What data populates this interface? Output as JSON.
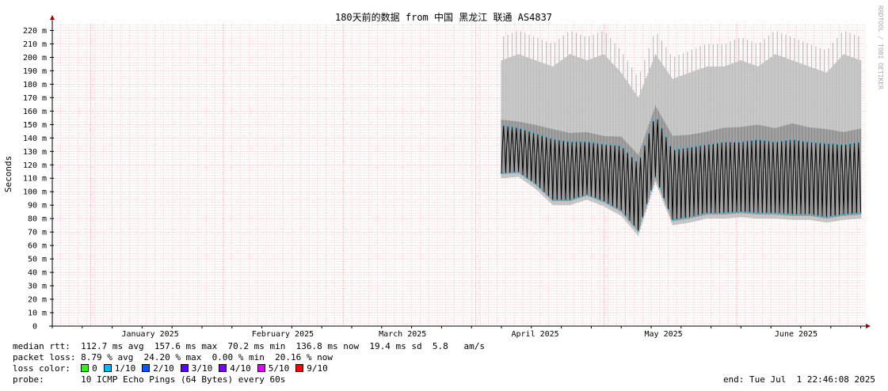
{
  "chart_data": {
    "type": "line",
    "title": "180天前的数据 from 中国 黑龙江 联通 AS4837",
    "ylabel": "Seconds",
    "watermark": "RRDTOOL / TOBI OETIKER",
    "ylim": [
      0,
      0.225
    ],
    "yticks": [
      {
        "value": 0,
        "label": "0"
      },
      {
        "value": 0.01,
        "label": "10 m"
      },
      {
        "value": 0.02,
        "label": "20 m"
      },
      {
        "value": 0.03,
        "label": "30 m"
      },
      {
        "value": 0.04,
        "label": "40 m"
      },
      {
        "value": 0.05,
        "label": "50 m"
      },
      {
        "value": 0.06,
        "label": "60 m"
      },
      {
        "value": 0.07,
        "label": "70 m"
      },
      {
        "value": 0.08,
        "label": "80 m"
      },
      {
        "value": 0.09,
        "label": "90 m"
      },
      {
        "value": 0.1,
        "label": "100 m"
      },
      {
        "value": 0.11,
        "label": "110 m"
      },
      {
        "value": 0.12,
        "label": "120 m"
      },
      {
        "value": 0.13,
        "label": "130 m"
      },
      {
        "value": 0.14,
        "label": "140 m"
      },
      {
        "value": 0.15,
        "label": "150 m"
      },
      {
        "value": 0.16,
        "label": "160 m"
      },
      {
        "value": 0.17,
        "label": "170 m"
      },
      {
        "value": 0.18,
        "label": "180 m"
      },
      {
        "value": 0.19,
        "label": "190 m"
      },
      {
        "value": 0.2,
        "label": "200 m"
      },
      {
        "value": 0.21,
        "label": "210 m"
      },
      {
        "value": 0.22,
        "label": "220 m"
      }
    ],
    "xlim": [
      "2024-12-23",
      "2025-07-01"
    ],
    "month_labels": [
      {
        "date": "2025-01-01",
        "label": "January 2025"
      },
      {
        "date": "2025-02-01",
        "label": "February 2025"
      },
      {
        "date": "2025-03-01",
        "label": "March 2025"
      },
      {
        "date": "2025-04-01",
        "label": "April 2025"
      },
      {
        "date": "2025-05-01",
        "label": "May 2025"
      },
      {
        "date": "2025-06-01",
        "label": "June 2025"
      }
    ],
    "grid": true,
    "data_start": "2025-04-07",
    "series": [
      {
        "x": [
          "2025-04-07",
          "2025-04-11",
          "2025-04-15",
          "2025-04-19",
          "2025-04-23",
          "2025-04-27",
          "2025-05-01",
          "2025-05-05",
          "2025-05-09",
          "2025-05-13",
          "2025-05-17",
          "2025-05-21",
          "2025-05-25",
          "2025-05-29",
          "2025-06-02",
          "2025-06-06",
          "2025-06-10",
          "2025-06-14",
          "2025-06-18",
          "2025-06-22",
          "2025-06-26",
          "2025-06-30"
        ],
        "median": [
          0.125,
          0.128,
          0.124,
          0.115,
          0.112,
          0.118,
          0.11,
          0.105,
          0.088,
          0.13,
          0.11,
          0.108,
          0.112,
          0.115,
          0.118,
          0.116,
          0.114,
          0.118,
          0.115,
          0.112,
          0.11,
          0.113
        ],
        "low": [
          0.113,
          0.114,
          0.105,
          0.093,
          0.093,
          0.097,
          0.092,
          0.085,
          0.07,
          0.11,
          0.078,
          0.08,
          0.083,
          0.083,
          0.084,
          0.083,
          0.083,
          0.082,
          0.082,
          0.08,
          0.082,
          0.083
        ],
        "high": [
          0.15,
          0.148,
          0.144,
          0.14,
          0.138,
          0.138,
          0.136,
          0.135,
          0.122,
          0.158,
          0.132,
          0.134,
          0.136,
          0.138,
          0.138,
          0.14,
          0.138,
          0.14,
          0.138,
          0.137,
          0.136,
          0.138
        ],
        "smoke_max": [
          0.215,
          0.22,
          0.215,
          0.21,
          0.22,
          0.215,
          0.22,
          0.205,
          0.185,
          0.22,
          0.2,
          0.205,
          0.21,
          0.21,
          0.215,
          0.21,
          0.22,
          0.215,
          0.21,
          0.205,
          0.22,
          0.215
        ]
      }
    ]
  },
  "legend": {
    "median_rtt": {
      "label": "median rtt:",
      "text": "112.7 ms avg  157.6 ms max  70.2 ms min  136.8 ms now  19.4 ms sd  5.8   am/s"
    },
    "packet_loss": {
      "label": "packet loss:",
      "text": "8.79 % avg  24.20 % max  0.00 % min  20.16 % now"
    },
    "loss_color": {
      "label": "loss color:",
      "items": [
        {
          "label": "0",
          "color": "#26ff00"
        },
        {
          "label": "1/10",
          "color": "#00b8ff"
        },
        {
          "label": "2/10",
          "color": "#0059ff"
        },
        {
          "label": "3/10",
          "color": "#5e00ff"
        },
        {
          "label": "4/10",
          "color": "#7e00ff"
        },
        {
          "label": "5/10",
          "color": "#dd00ff"
        },
        {
          "label": "9/10",
          "color": "#ff0000"
        }
      ]
    },
    "probe": {
      "label": "probe:",
      "text": "10 ICMP Echo Pings (64 Bytes) every 60s"
    },
    "end": "end: Tue Jul  1 22:46:08 2025"
  },
  "colors": {
    "grid_minor": "#f2b4b4",
    "grid_major": "#e88888",
    "axis": "#000000",
    "smoke": "#bdbdbd",
    "median": "#000000",
    "median_dot": "#00b8ff"
  }
}
